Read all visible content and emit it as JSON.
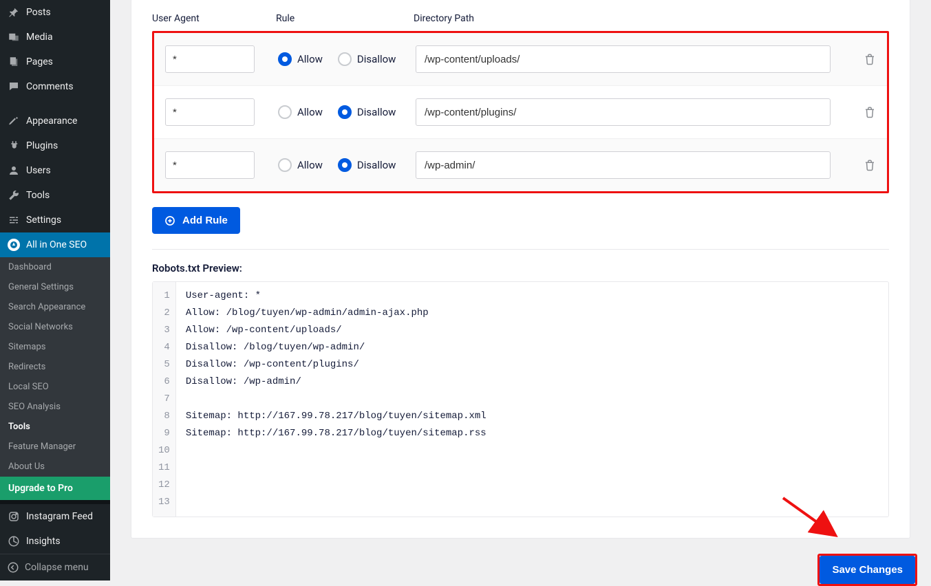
{
  "sidebar": {
    "items": [
      {
        "label": "Posts"
      },
      {
        "label": "Media"
      },
      {
        "label": "Pages"
      },
      {
        "label": "Comments"
      },
      {
        "label": "Appearance"
      },
      {
        "label": "Plugins"
      },
      {
        "label": "Users"
      },
      {
        "label": "Tools"
      },
      {
        "label": "Settings"
      },
      {
        "label": "All in One SEO"
      }
    ],
    "submenu": [
      {
        "label": "Dashboard"
      },
      {
        "label": "General Settings"
      },
      {
        "label": "Search Appearance"
      },
      {
        "label": "Social Networks"
      },
      {
        "label": "Sitemaps"
      },
      {
        "label": "Redirects"
      },
      {
        "label": "Local SEO"
      },
      {
        "label": "SEO Analysis"
      },
      {
        "label": "Tools",
        "bold": true
      },
      {
        "label": "Feature Manager"
      },
      {
        "label": "About Us"
      }
    ],
    "upgrade": "Upgrade to Pro",
    "extra": [
      {
        "label": "Instagram Feed"
      },
      {
        "label": "Insights"
      }
    ],
    "collapse": "Collapse menu"
  },
  "headers": {
    "ua": "User Agent",
    "rule": "Rule",
    "path": "Directory Path"
  },
  "ruleLabels": {
    "allow": "Allow",
    "disallow": "Disallow"
  },
  "rules": [
    {
      "ua": "*",
      "rule": "allow",
      "path": "/wp-content/uploads/"
    },
    {
      "ua": "*",
      "rule": "disallow",
      "path": "/wp-content/plugins/"
    },
    {
      "ua": "*",
      "rule": "disallow",
      "path": "/wp-admin/"
    }
  ],
  "addRule": "Add Rule",
  "previewLabel": "Robots.txt Preview:",
  "previewLines": [
    "User-agent: *",
    "Allow: /blog/tuyen/wp-admin/admin-ajax.php",
    "Allow: /wp-content/uploads/",
    "Disallow: /blog/tuyen/wp-admin/",
    "Disallow: /wp-content/plugins/",
    "Disallow: /wp-admin/",
    "",
    "Sitemap: http://167.99.78.217/blog/tuyen/sitemap.xml",
    "Sitemap: http://167.99.78.217/blog/tuyen/sitemap.rss",
    "",
    "",
    "",
    ""
  ],
  "saveChanges": "Save Changes"
}
